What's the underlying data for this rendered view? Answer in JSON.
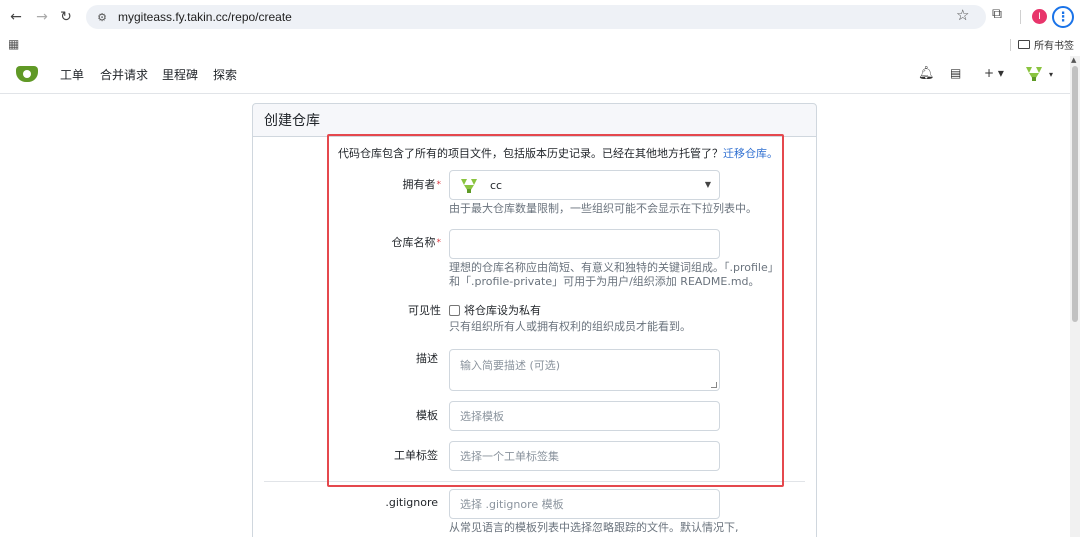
{
  "browser": {
    "url": "mygiteass.fy.takin.cc/repo/create",
    "profile_initial": "I",
    "bookmarks_folder": "所有书签"
  },
  "nav": {
    "items": [
      "工单",
      "合并请求",
      "里程碑",
      "探索"
    ],
    "add_caret": "+ ▾",
    "avatar_caret": "▾"
  },
  "form": {
    "title": "创建仓库",
    "intro_text": "代码仓库包含了所有的项目文件，包括版本历史记录。已经在其他地方托管了？",
    "migrate_link": "迁移仓库。",
    "owner": {
      "label": "拥有者",
      "value": "cc",
      "help": "由于最大仓库数量限制，一些组织可能不会显示在下拉列表中。"
    },
    "repo_name": {
      "label": "仓库名称",
      "help_line1": "理想的仓库名称应由简短、有意义和独特的关键词组成。「.profile」",
      "help_line2": "和「.profile-private」可用于为用户/组织添加 README.md。"
    },
    "visibility": {
      "label": "可见性",
      "checkbox_label": "将仓库设为私有",
      "help": "只有组织所有人或拥有权利的组织成员才能看到。"
    },
    "description": {
      "label": "描述",
      "placeholder": "输入简要描述 (可选)"
    },
    "template": {
      "label": "模板",
      "placeholder": "选择模板"
    },
    "issue_labels": {
      "label": "工单标签",
      "placeholder": "选择一个工单标签集"
    },
    "gitignore": {
      "label": ".gitignore",
      "placeholder": "选择 .gitignore 模板",
      "help": "从常见语言的模板列表中选择忽略跟踪的文件。默认情况下,"
    }
  },
  "colors": {
    "accent": "#609926",
    "link": "#2f6fd1",
    "highlight": "#e5484d"
  }
}
